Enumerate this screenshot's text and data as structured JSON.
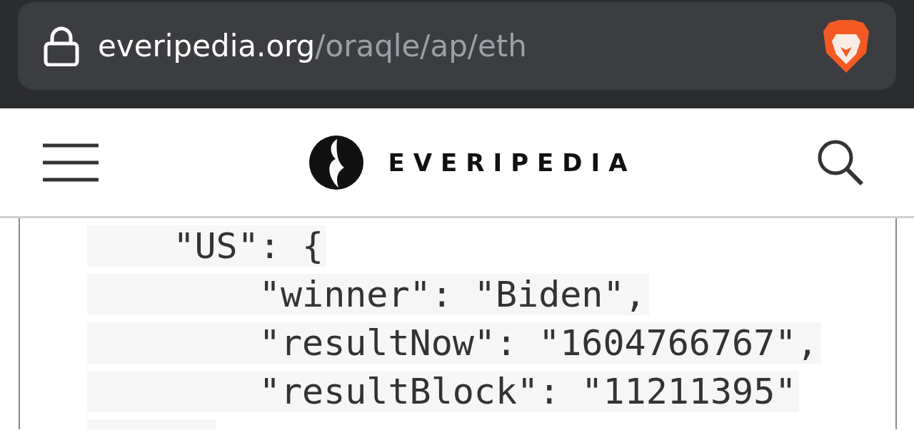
{
  "address_bar": {
    "domain": "everipedia.org",
    "path": "/oraqle/ap/eth"
  },
  "header": {
    "logo_text": "EVERIPEDIA"
  },
  "code": {
    "lines": [
      {
        "text": "    \"US\": {"
      },
      {
        "text": "        \"winner\": \"Biden\","
      },
      {
        "text": "        \"resultNow\": \"1604766767\","
      },
      {
        "text": "        \"resultBlock\": \"11211395\""
      }
    ]
  }
}
